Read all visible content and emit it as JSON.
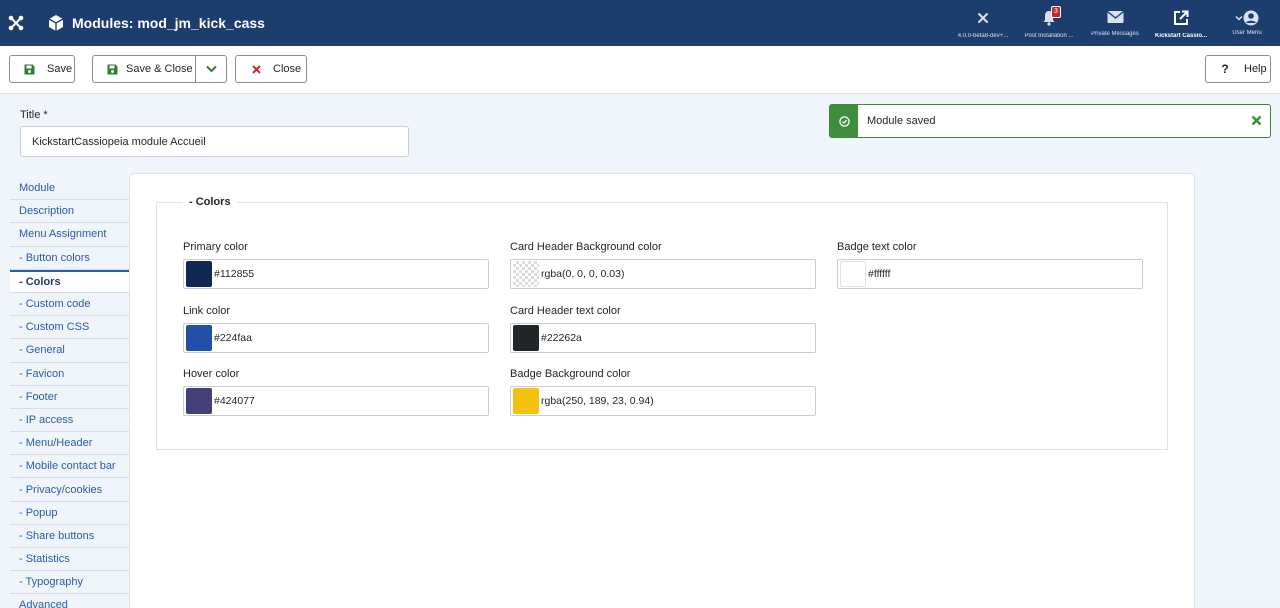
{
  "header": {
    "title": "Modules: mod_jm_kick_cass",
    "items": [
      {
        "label": "4.0.0-beta8-dev+...",
        "icon": "joomla-icon"
      },
      {
        "label": "Post Installation ...",
        "icon": "bell-icon",
        "count": "3"
      },
      {
        "label": "Private Messages",
        "icon": "envelope-icon"
      },
      {
        "label": "Kickstart Cassio...",
        "icon": "external-link-icon"
      },
      {
        "label": "User Menu",
        "icon": "user-icon"
      }
    ]
  },
  "toolbar": {
    "save": "Save",
    "save_close": "Save & Close",
    "close": "Close",
    "help": "Help"
  },
  "form": {
    "title_label": "Title *",
    "title_value": "KickstartCassiopeia module Accueil"
  },
  "alert": {
    "message": "Module saved"
  },
  "tabs": [
    {
      "label": "Module"
    },
    {
      "label": "Description"
    },
    {
      "label": "Menu Assignment"
    },
    {
      "label": "- Button colors"
    },
    {
      "label": "- Colors"
    },
    {
      "label": "- Custom code"
    },
    {
      "label": "- Custom CSS"
    },
    {
      "label": "- General"
    },
    {
      "label": "- Favicon"
    },
    {
      "label": "- Footer"
    },
    {
      "label": "- IP access"
    },
    {
      "label": "- Menu/Header"
    },
    {
      "label": "- Mobile contact bar"
    },
    {
      "label": "- Privacy/cookies"
    },
    {
      "label": "- Popup"
    },
    {
      "label": "- Share buttons"
    },
    {
      "label": "- Statistics"
    },
    {
      "label": "- Typography"
    },
    {
      "label": "Advanced"
    }
  ],
  "active_tab": "- Colors",
  "colors": {
    "legend": "- Colors",
    "fields": [
      {
        "label": "Primary color",
        "value": "#112855",
        "swatch": "#112855"
      },
      {
        "label": "Link color",
        "value": "#224faa",
        "swatch": "#224faa"
      },
      {
        "label": "Hover color",
        "value": "#424077",
        "swatch": "#424077"
      },
      {
        "label": "Card Header Background color",
        "value": "rgba(0, 0, 0, 0.03)",
        "swatch": "transparent"
      },
      {
        "label": "Card Header text color",
        "value": "#22262a",
        "swatch": "#22262a"
      },
      {
        "label": "Badge Background color",
        "value": "rgba(250, 189, 23, 0.94)",
        "swatch": "#f5c111"
      },
      {
        "label": "Badge text color",
        "value": "#ffffff",
        "swatch": "#ffffff"
      }
    ]
  }
}
